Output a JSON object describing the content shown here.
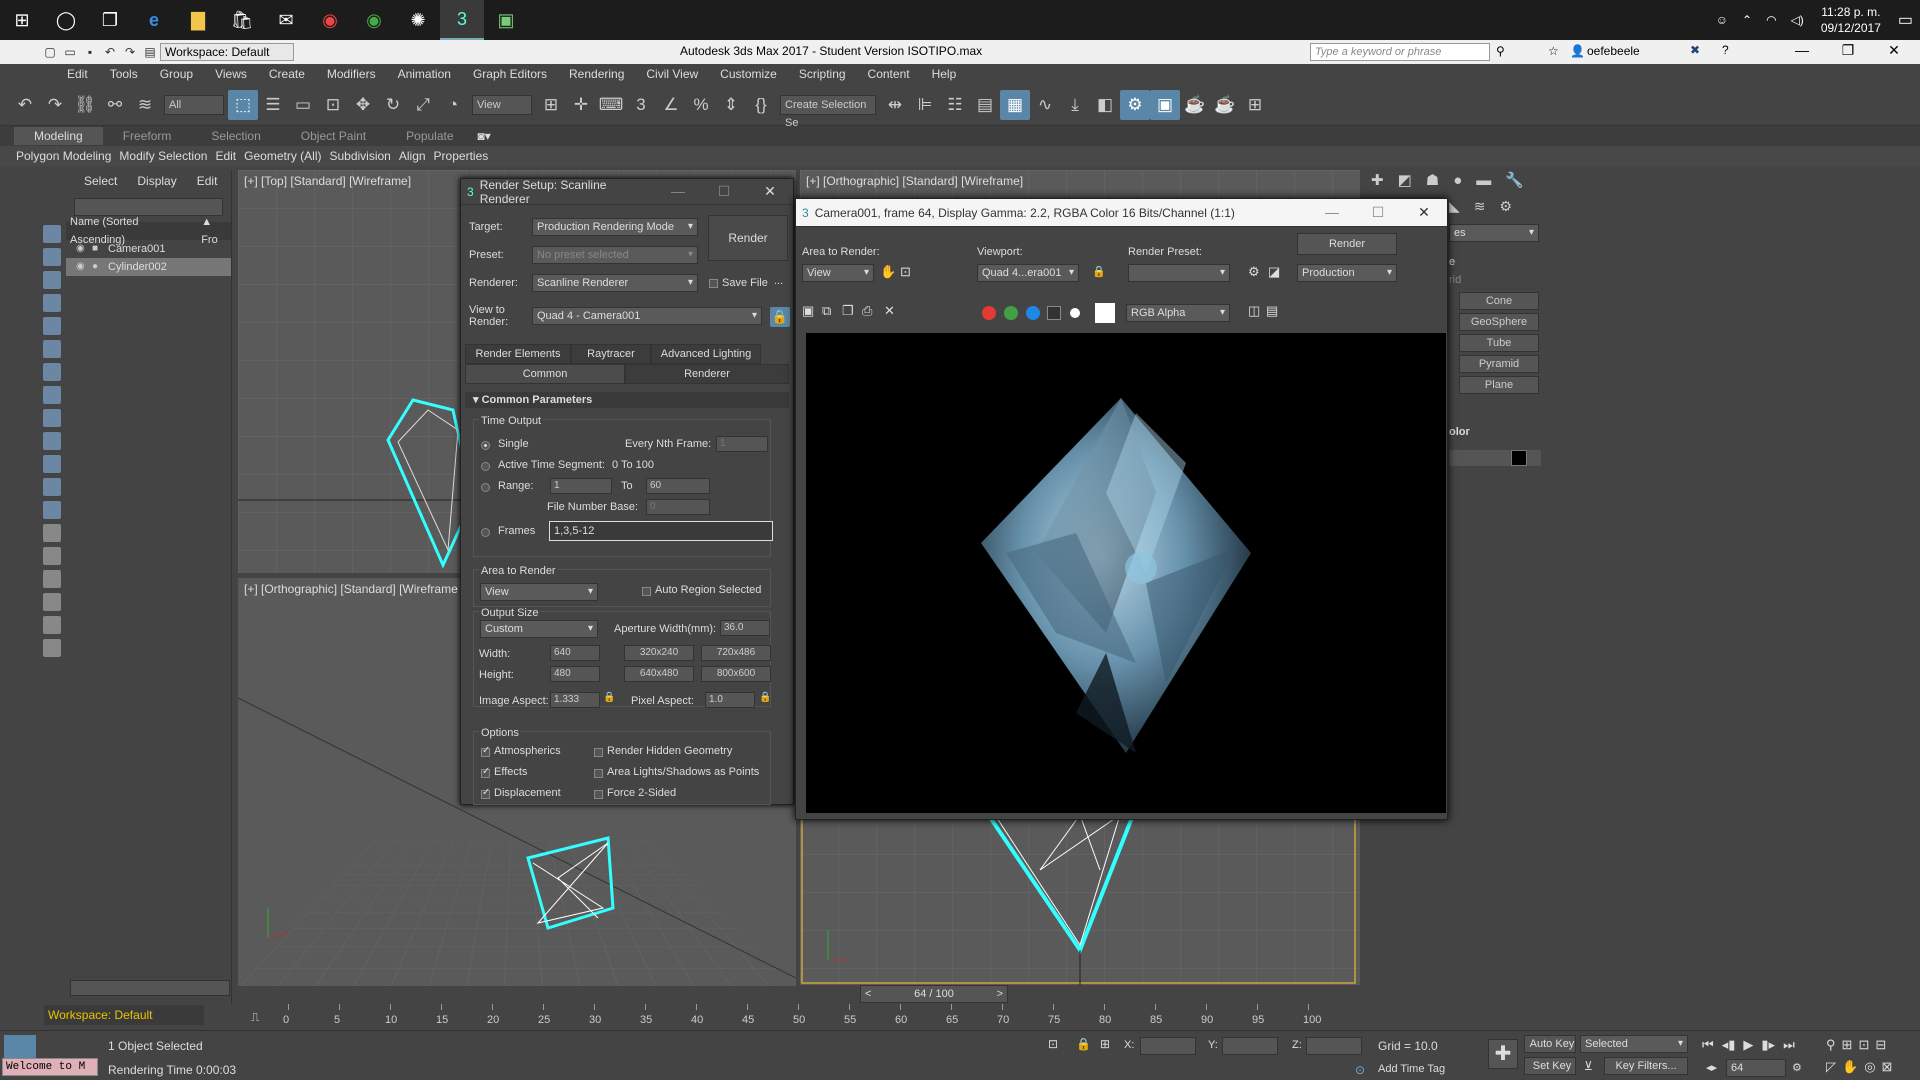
{
  "taskbar": {
    "icons": [
      "windows-start",
      "cortana",
      "task-view",
      "edge",
      "file-explorer",
      "store",
      "mail",
      "chrome",
      "chrome-alt",
      "settings-app",
      "3dsmax",
      "photo-app"
    ],
    "tray": {
      "time": "11:28 p. m.",
      "date": "09/12/2017"
    }
  },
  "titlebar": {
    "workspace": "Workspace: Default",
    "title": "Autodesk 3ds Max 2017 - Student Version   ISOTIPO.max",
    "search_placeholder": "Type a keyword or phrase",
    "user": "oefebeele"
  },
  "menu": [
    "Edit",
    "Tools",
    "Group",
    "Views",
    "Create",
    "Modifiers",
    "Animation",
    "Graph Editors",
    "Rendering",
    "Civil View",
    "Customize",
    "Scripting",
    "Content",
    "Help"
  ],
  "toolbar": {
    "filter": "All",
    "view_drop": "View",
    "selset": "Create Selection Se"
  },
  "ribbon": {
    "tabs": [
      "Modeling",
      "Freeform",
      "Selection",
      "Object Paint",
      "Populate"
    ],
    "sub": [
      "Polygon Modeling",
      "Modify Selection",
      "Edit",
      "Geometry (All)",
      "Subdivision",
      "Align",
      "Properties"
    ]
  },
  "scene": {
    "tabs": [
      "Select",
      "Display",
      "Edit"
    ],
    "col_name": "Name (Sorted Ascending)",
    "col_fro": "▲ Fro",
    "items": [
      {
        "name": "Camera001"
      },
      {
        "name": "Cylinder002"
      }
    ]
  },
  "viewports": {
    "top": "[+] [Top] [Standard] [Wireframe]",
    "ortho1": "[+] [Orthographic] [Standard] [Wireframe]",
    "ortho2": "[+] [Orthographic] [Standard] [Wireframe",
    "cam": "[+] [Orthographic] [Standard] [Wireframe]"
  },
  "cmdpanel": {
    "obj_types": [
      "Cone",
      "GeoSphere",
      "Tube",
      "Pyramid",
      "Plane"
    ],
    "dropdown": "es",
    "rid": "rid",
    "color_label": "olor",
    "e": "e"
  },
  "render_setup": {
    "title": "Render Setup: Scanline Renderer",
    "target_label": "Target:",
    "target": "Production Rendering Mode",
    "preset_label": "Preset:",
    "preset": "No preset selected",
    "renderer_label": "Renderer:",
    "renderer": "Scanline Renderer",
    "savefile": "Save File",
    "view_label": "View to\nRender:",
    "view": "Quad 4 - Camera001",
    "render_btn": "Render",
    "tabs": [
      "Render Elements",
      "Raytracer",
      "Advanced Lighting",
      "Common",
      "Renderer"
    ],
    "rollout": "Common Parameters",
    "time_output": "Time Output",
    "single": "Single",
    "every_nth": "Every Nth Frame:",
    "every_nth_val": "1",
    "active_seg": "Active Time Segment:",
    "active_seg_val": "0 To 100",
    "range": "Range:",
    "range_from": "1",
    "range_to_label": "To",
    "range_to": "60",
    "file_num_base": "File Number Base:",
    "file_num_val": "0",
    "frames": "Frames",
    "frames_val": "1,3,5-12",
    "area_label": "Area to Render",
    "area": "View",
    "auto_region": "Auto Region Selected",
    "output_size": "Output Size",
    "size_preset": "Custom",
    "aperture": "Aperture Width(mm):",
    "aperture_val": "36.0",
    "width_label": "Width:",
    "width": "640",
    "height_label": "Height:",
    "height": "480",
    "presets": [
      "320x240",
      "720x486",
      "640x480",
      "800x600"
    ],
    "image_aspect": "Image Aspect:",
    "image_aspect_val": "1.333",
    "pixel_aspect": "Pixel Aspect:",
    "pixel_aspect_val": "1.0",
    "options": "Options",
    "opts": [
      "Atmospherics",
      "Effects",
      "Displacement"
    ],
    "opts2": [
      "Render Hidden Geometry",
      "Area Lights/Shadows as Points",
      "Force 2-Sided"
    ]
  },
  "frame_window": {
    "title": "Camera001, frame 64, Display Gamma: 2.2, RGBA Color 16 Bits/Channel (1:1)",
    "area_label": "Area to Render:",
    "area": "View",
    "viewport_label": "Viewport:",
    "viewport": "Quad 4...era001",
    "preset_label": "Render Preset:",
    "render_btn": "Render",
    "mode": "Production",
    "channel": "RGB Alpha",
    "colors": {
      "red": "#e53935",
      "green": "#43a047",
      "blue": "#1e88e5"
    }
  },
  "timeline": {
    "frame": "64 / 100",
    "ticks": [
      0,
      5,
      10,
      15,
      20,
      25,
      30,
      35,
      40,
      45,
      50,
      55,
      60,
      65,
      70,
      75,
      80,
      85,
      90,
      95,
      100
    ]
  },
  "status": {
    "workspace": "Workspace: Default",
    "welcome": "Welcome to M",
    "selected": "1 Object Selected",
    "render_time": "Rendering Time  0:00:03",
    "x": "X:",
    "y": "Y:",
    "z": "Z:",
    "grid": "Grid = 10.0",
    "add_time_tag": "Add Time Tag",
    "auto_key": "Auto Key",
    "set_key": "Set Key",
    "sel_drop": "Selected",
    "key_filters": "Key Filters...",
    "frame_num": "64"
  }
}
